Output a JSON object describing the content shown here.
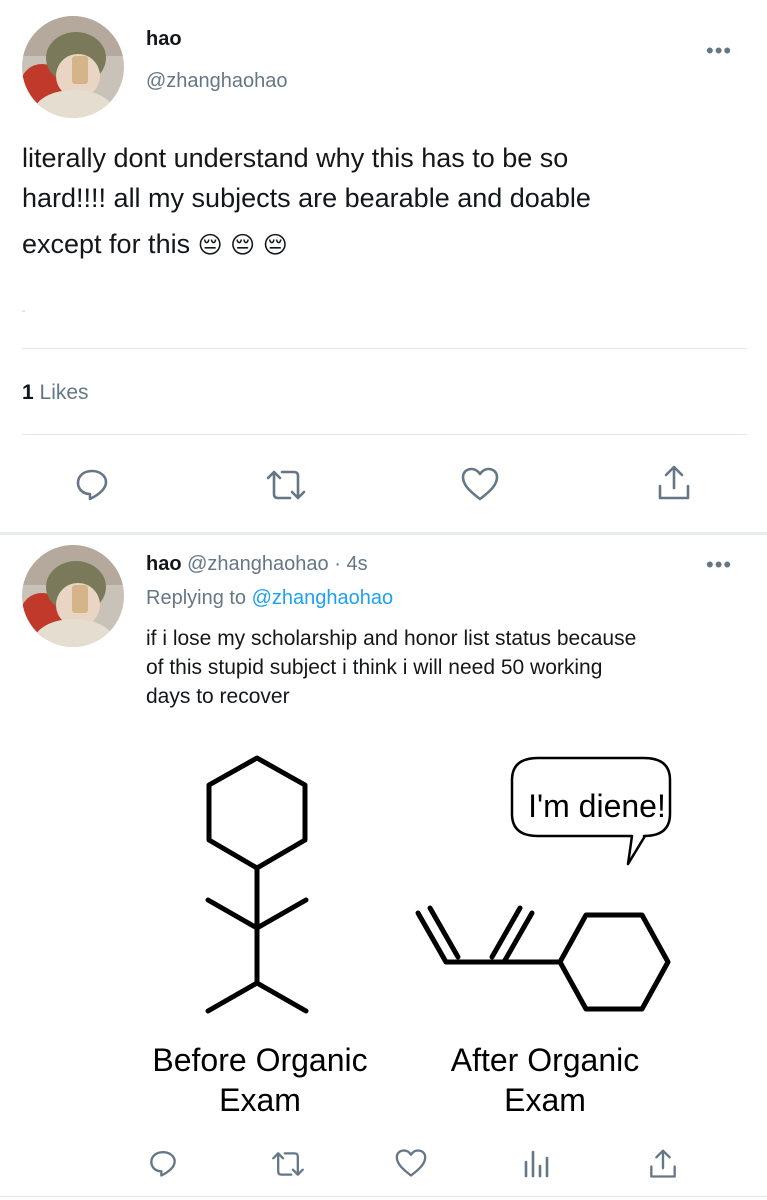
{
  "tweet": {
    "author_name": "hao",
    "author_handle": "@zhanghaohao",
    "more_label": "•••",
    "text_line1": "literally dont understand why this has to be so",
    "text_line2": "hard!!!! all my subjects are bearable and doable",
    "text_line3": "except for this",
    "emojis": [
      "😔",
      "😔",
      "😔"
    ],
    "stray_mark": "-",
    "likes_count": "1",
    "likes_label": "Likes"
  },
  "reply": {
    "author_name": "hao",
    "author_handle": "@zhanghaohao",
    "separator": "·",
    "time": "4s",
    "replying_prefix": "Replying to",
    "replying_to": "@zhanghaohao",
    "more_label": "•••",
    "text_line1": "if i lose my scholarship and honor list status because",
    "text_line2": "of this stupid subject i think i will need 50 working",
    "text_line3": "days to recover",
    "meme": {
      "bubble_text": "I'm diene!",
      "left_label_line1": "Before Organic",
      "left_label_line2": "Exam",
      "right_label_line1": "After Organic",
      "right_label_line2": "Exam"
    }
  },
  "actions_main": [
    "reply-icon",
    "retweet-icon",
    "like-icon",
    "share-icon"
  ],
  "actions_reply": [
    "reply-icon",
    "retweet-icon",
    "like-icon",
    "analytics-icon",
    "share-icon"
  ],
  "colors": {
    "icon": "#657786",
    "link": "#1da1f2",
    "divider": "#e1e8ed"
  }
}
